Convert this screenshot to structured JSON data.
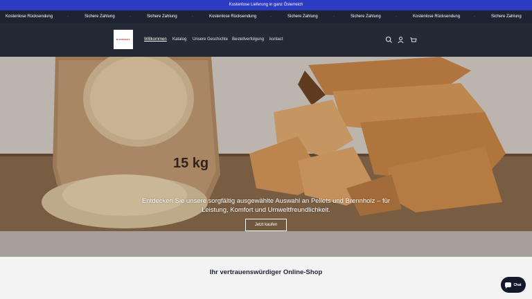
{
  "announcement": "Kostenlose Lieferung in ganz Österreich",
  "ticker": {
    "items": [
      "Kostenlose Rücksendung",
      "Sichere Zahlung",
      "Sichere Zahlung",
      "Kostenlose Rücksendung",
      "Sichere Zahlung",
      "Sichere Zahlung",
      "Kostenlose Rücksendung",
      "Sichere Zahlung"
    ],
    "separator": "·"
  },
  "header": {
    "logo_text": "NUTKRAFT",
    "nav": [
      "Willkommen",
      "Katalog",
      "Unsere Geschichte",
      "Bestellverfolgung",
      "kontact"
    ],
    "icons": [
      "search-icon",
      "account-icon",
      "cart-icon"
    ]
  },
  "hero": {
    "bag_label": "15 kg",
    "text": "Entdecken Sie unsere sorgfältig ausgewählte Auswahl an Pellets und Brennholz – für Leistung, Komfort und Umweltfreundlichkeit.",
    "button": "Jetzt kaufen"
  },
  "section": {
    "title": "Ihr vertrauenswürdiger Online-Shop"
  },
  "chat": {
    "label": "Chat"
  },
  "colors": {
    "announcement_bg": "#2b3cc2",
    "header_bg": "#232a36",
    "ticker_bg": "#1c2431"
  }
}
